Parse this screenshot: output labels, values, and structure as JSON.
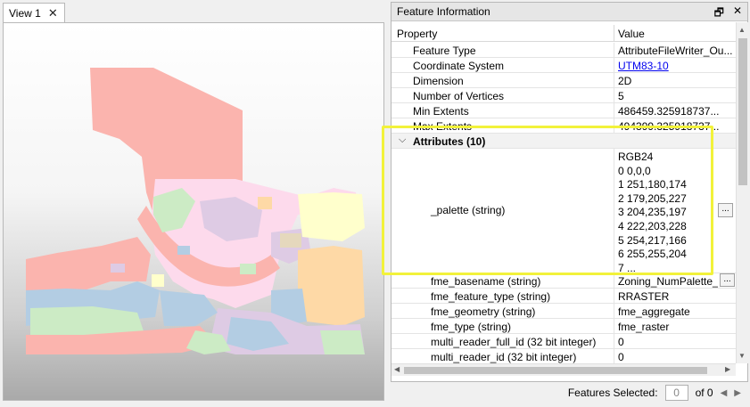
{
  "view": {
    "tab_label": "View 1",
    "close_glyph": "✕"
  },
  "panel": {
    "title": "Feature Information",
    "float_glyph": "🗗",
    "close_glyph": "✕",
    "columns": {
      "property": "Property",
      "value": "Value"
    },
    "rows_top": [
      {
        "property": "Feature Type",
        "value": "AttributeFileWriter_Ou..."
      },
      {
        "property": "Coordinate System",
        "value": "UTM83-10"
      },
      {
        "property": "Dimension",
        "value": "2D"
      },
      {
        "property": "Number of Vertices",
        "value": "5"
      },
      {
        "property": "Min Extents",
        "value": "486459.325918737..."
      },
      {
        "property": "Max Extents",
        "value": "494399.325918737..."
      }
    ],
    "attributes_header": "Attributes (10)",
    "palette": {
      "property": "_palette (string)",
      "lines": [
        "RGB24",
        "0 0,0,0",
        "1 251,180,174",
        "2 179,205,227",
        "3 204,235,197",
        "4 222,203,228",
        "5 254,217,166",
        "6 255,255,204",
        "7 ..."
      ],
      "button": "..."
    },
    "rows_attr": [
      {
        "property": "fme_basename (string)",
        "value": "Zoning_NumPalette_R..."
      },
      {
        "property": "fme_feature_type (string)",
        "value": "RRASTER"
      },
      {
        "property": "fme_geometry (string)",
        "value": "fme_aggregate"
      },
      {
        "property": "fme_type (string)",
        "value": "fme_raster"
      },
      {
        "property": "multi_reader_full_id (32 bit integer)",
        "value": "0"
      },
      {
        "property": "multi_reader_id (32 bit integer)",
        "value": "0"
      }
    ]
  },
  "status": {
    "label": "Features Selected:",
    "count": "0",
    "of": "of 0"
  },
  "colors": {
    "salmon": "#fbb4ae",
    "blue": "#b3cde3",
    "green": "#ccebc5",
    "purple": "#decbe4",
    "orange": "#fed9a6",
    "yellow": "#ffffcc",
    "pink": "#fddaec",
    "tan": "#e5d8bd",
    "highlight": "#f2f23a"
  }
}
